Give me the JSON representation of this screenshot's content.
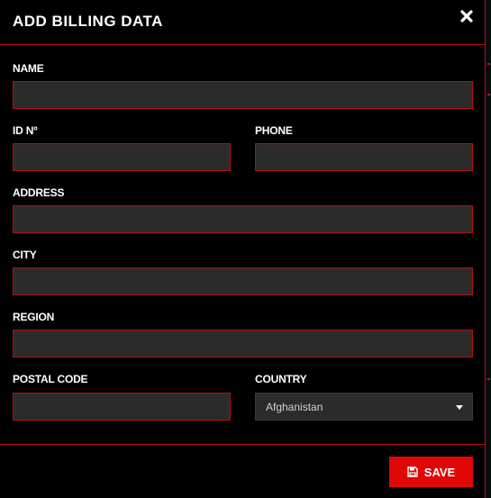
{
  "modal": {
    "title": "ADD BILLING DATA",
    "close_icon": "close-icon"
  },
  "form": {
    "name_label": "NAME",
    "name_value": "",
    "id_label": "ID Nº",
    "id_value": "",
    "phone_label": "PHONE",
    "phone_value": "",
    "address_label": "ADDRESS",
    "address_value": "",
    "city_label": "CITY",
    "city_value": "",
    "region_label": "REGION",
    "region_value": "",
    "postal_label": "POSTAL CODE",
    "postal_value": "",
    "country_label": "COUNTRY",
    "country_selected": "Afghanistan"
  },
  "footer": {
    "save_label": "SAVE",
    "save_icon": "floppy-disk-icon"
  },
  "colors": {
    "accent": "#e00707",
    "border": "#b80d0d",
    "field_bg": "#2b2b2b",
    "background": "#000000"
  }
}
